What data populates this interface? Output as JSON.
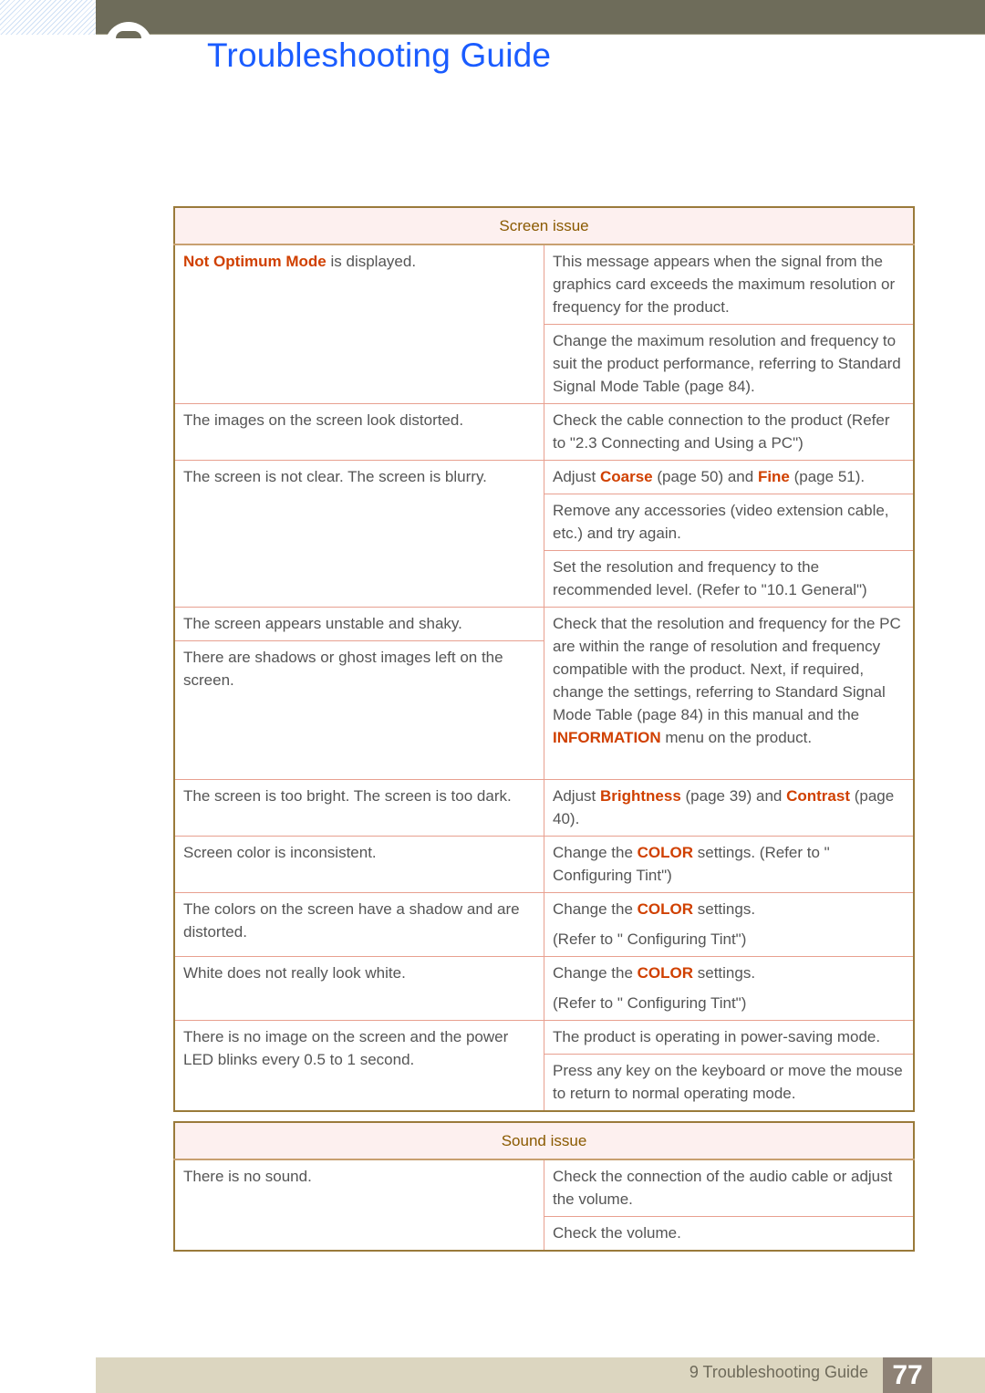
{
  "header": {
    "title": "Troubleshooting Guide"
  },
  "screen": {
    "heading": "Screen issue",
    "r1l": [
      {
        "t": "Not Optimum Mode",
        "hl": true
      },
      {
        "t": " is displayed."
      }
    ],
    "r1a": [
      {
        "t": "This message appears when the signal from the graphics card exceeds the maximum resolution or frequency for the product."
      }
    ],
    "r1b": [
      {
        "t": "Change the maximum resolution and frequency to suit the product performance, referring to Standard Signal Mode Table (page 84)."
      }
    ],
    "r2l": [
      {
        "t": "The images on the screen look distorted."
      }
    ],
    "r2a": [
      {
        "t": "Check the cable connection to the product (Refer to \"2.3 Connecting and Using a PC\")"
      }
    ],
    "r3l": [
      {
        "t": "The screen is not clear. The screen is blurry."
      }
    ],
    "r3a": [
      {
        "t": "Adjust "
      },
      {
        "t": "Coarse",
        "hl": true
      },
      {
        "t": " (page 50) and "
      },
      {
        "t": "Fine",
        "hl": true
      },
      {
        "t": " (page 51)."
      }
    ],
    "r3b": [
      {
        "t": "Remove any accessories (video extension cable, etc.) and try again."
      }
    ],
    "r3c": [
      {
        "t": "Set the resolution and frequency to the recommended level. (Refer to \"10.1 General\")"
      }
    ],
    "r4l": [
      {
        "t": "The screen appears unstable and shaky."
      }
    ],
    "r4l2": [
      {
        "t": "There are shadows or ghost images left on the screen."
      }
    ],
    "r4a": [
      {
        "t": "Check that the resolution and frequency for the PC are within the range of resolution and frequency compatible with the product. Next, if required, change the settings, referring to Standard Signal Mode Table (page 84) in this manual and the "
      },
      {
        "t": "INFORMATION",
        "hl": true
      },
      {
        "t": " menu on the product."
      }
    ],
    "r5l": [
      {
        "t": "The screen is too bright. The screen is too dark."
      }
    ],
    "r5a": [
      {
        "t": "Adjust "
      },
      {
        "t": "Brightness",
        "hl": true
      },
      {
        "t": " (page 39) and "
      },
      {
        "t": "Contrast",
        "hl": true
      },
      {
        "t": " (page 40)."
      }
    ],
    "r6l": [
      {
        "t": "Screen color is inconsistent."
      }
    ],
    "r6a": [
      {
        "t": "Change the "
      },
      {
        "t": "COLOR",
        "hl": true
      },
      {
        "t": " settings. (Refer to \" Configuring Tint\")"
      }
    ],
    "r7l": [
      {
        "t": "The colors on the screen have a shadow and are distorted."
      }
    ],
    "r7a": [
      {
        "t": "Change the "
      },
      {
        "t": "COLOR",
        "hl": true
      },
      {
        "t": " settings."
      }
    ],
    "r7a2": [
      {
        "t": "(Refer to \" Configuring Tint\")"
      }
    ],
    "r8l": [
      {
        "t": "White does not really look white."
      }
    ],
    "r8a": [
      {
        "t": "Change the "
      },
      {
        "t": "COLOR",
        "hl": true
      },
      {
        "t": " settings."
      }
    ],
    "r8a2": [
      {
        "t": "(Refer to \" Configuring Tint\")"
      }
    ],
    "r9l": [
      {
        "t": "There is no image on the screen and the power LED blinks every 0.5 to 1 second."
      }
    ],
    "r9a": [
      {
        "t": "The product is operating in power-saving mode."
      }
    ],
    "r9b": [
      {
        "t": "Press any key on the keyboard or move the mouse to return to normal operating mode."
      }
    ]
  },
  "sound": {
    "heading": "Sound issue",
    "r1l": [
      {
        "t": "There is no sound."
      }
    ],
    "r1a": [
      {
        "t": "Check the connection of the audio cable or adjust the volume."
      }
    ],
    "r1b": [
      {
        "t": "Check the volume."
      }
    ]
  },
  "footer": {
    "section": "9 Troubleshooting Guide",
    "page": "77"
  },
  "colors": {
    "title": "#1a5cff",
    "highlight": "#d04000",
    "topbar": "#6e6c5a",
    "table_head_text": "#8a5a00"
  }
}
